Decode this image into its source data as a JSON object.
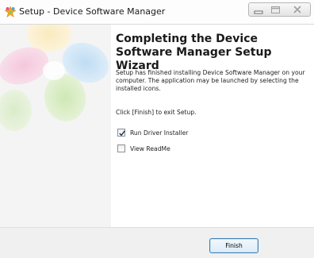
{
  "window": {
    "title": "Setup - Device Software Manager",
    "icon": "setup-star-icon"
  },
  "controls": {
    "minimize_icon": "minimize-icon",
    "maximize_icon": "maximize-icon",
    "close_icon": "close-icon"
  },
  "sidebar": {
    "image": "colorful-petal-banner"
  },
  "content": {
    "heading": "Completing the Device Software Manager Setup Wizard",
    "paragraph": "Setup has finished installing Device Software Manager on your computer. The application may be launched by selecting the installed icons.",
    "exit_instruction": "Click [Finish] to exit Setup.",
    "options": [
      {
        "label": "Run Driver Installer",
        "checked": true
      },
      {
        "label": "View ReadMe",
        "checked": false
      }
    ]
  },
  "footer": {
    "finish_label": "Finish"
  },
  "colors": {
    "button_border": "#3c7fb1",
    "footer_bg": "#f0f0f0",
    "sidebar_bg": "#f4f4f4"
  }
}
